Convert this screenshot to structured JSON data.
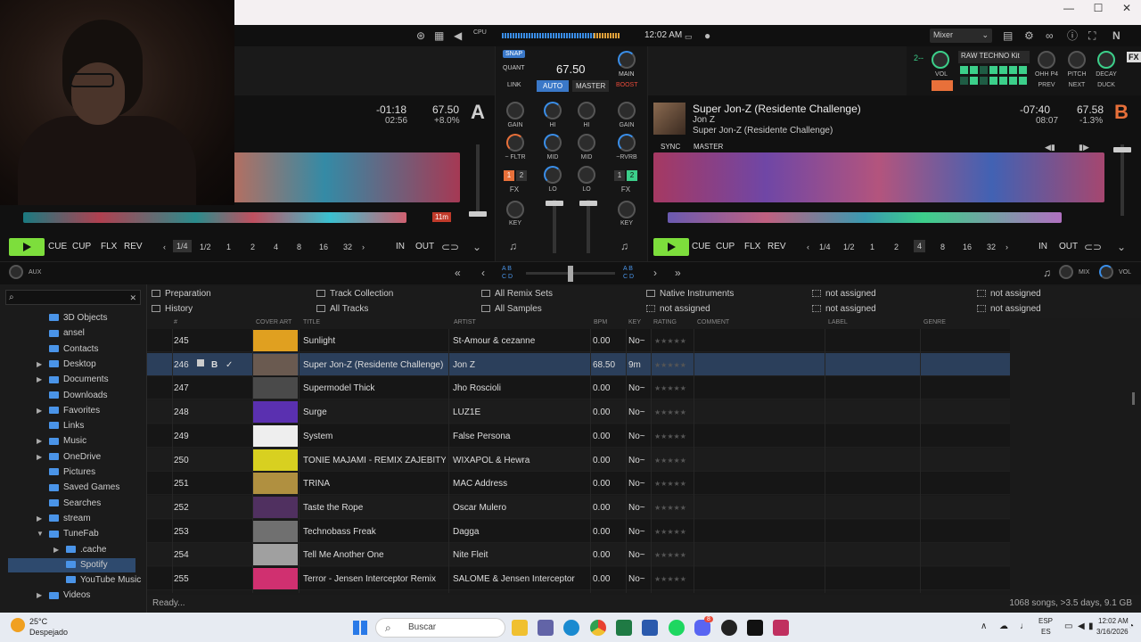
{
  "window": {
    "minimize": "—",
    "maximize": "☐",
    "close": "✕"
  },
  "header": {
    "cpu_label": "CPU",
    "clock": "12:02 AM",
    "layout_select": "Mixer"
  },
  "deckA": {
    "time_remaining": "-01:18",
    "time_total": "02:56",
    "bpm": "67.50",
    "pitch": "+8.0%",
    "letter": "A",
    "accent": "#cfcfcf",
    "transport": {
      "cue": "CUE",
      "cup": "CUP",
      "flx": "FLX",
      "rev": "REV",
      "in": "IN",
      "out": "OUT"
    },
    "beats": [
      "1/4",
      "1/2",
      "1",
      "2",
      "4",
      "8",
      "16",
      "32"
    ],
    "selected_beat": "1/4",
    "loop_length": "11m",
    "aux": "AUX"
  },
  "deckB": {
    "title": "Super Jon-Z (Residente Challenge)",
    "artist": "Jon Z",
    "album": "Super Jon-Z (Residente Challenge)",
    "time_remaining": "-07:40",
    "time_total": "08:07",
    "bpm": "67.58",
    "pitch": "-1.3%",
    "letter": "B",
    "accent": "#e8703a",
    "sync": "SYNC",
    "master": "MASTER",
    "transport": {
      "cue": "CUE",
      "cup": "CUP",
      "flx": "FLX",
      "rev": "REV",
      "in": "IN",
      "out": "OUT"
    },
    "beats": [
      "1/4",
      "1/2",
      "1",
      "2",
      "4",
      "8",
      "16",
      "32"
    ],
    "selected_beat": "4",
    "mix": "MIX",
    "vol": "VOL"
  },
  "mixer": {
    "snap": "SNAP",
    "quant": "QUANT",
    "master_bpm": "67.50",
    "main": "MAIN",
    "link": "LINK",
    "auto": "AUTO",
    "master": "MASTER",
    "boost": "BOOST",
    "gain": "GAIN",
    "hi": "HI",
    "mid": "MID",
    "lo": "LO",
    "fx": "FX",
    "key": "KEY",
    "fltr": "~ FLTR",
    "rvrb": "~RVRB",
    "fx_a": [
      "1",
      "2"
    ],
    "fx_b": [
      "1",
      "2"
    ]
  },
  "remix": {
    "deck_label": "2--",
    "kit": "RAW TECHNO Kit",
    "vol": "VOL",
    "ohh": "OHH P4",
    "pitch": "PITCH",
    "decay": "DECAY",
    "prev": "PREV",
    "next": "NEXT",
    "duck": "DUCK",
    "fx": "FX"
  },
  "crossfader": {
    "a_labels": [
      "A",
      "B",
      "C",
      "D"
    ],
    "b_labels": [
      "A",
      "B",
      "C",
      "D"
    ]
  },
  "sidebar": {
    "search_placeholder": "",
    "items": [
      {
        "label": "3D Objects",
        "arrow": ""
      },
      {
        "label": "ansel",
        "arrow": ""
      },
      {
        "label": "Contacts",
        "arrow": ""
      },
      {
        "label": "Desktop",
        "arrow": "▶"
      },
      {
        "label": "Documents",
        "arrow": "▶"
      },
      {
        "label": "Downloads",
        "arrow": ""
      },
      {
        "label": "Favorites",
        "arrow": "▶"
      },
      {
        "label": "Links",
        "arrow": ""
      },
      {
        "label": "Music",
        "arrow": "▶"
      },
      {
        "label": "OneDrive",
        "arrow": "▶"
      },
      {
        "label": "Pictures",
        "arrow": ""
      },
      {
        "label": "Saved Games",
        "arrow": ""
      },
      {
        "label": "Searches",
        "arrow": ""
      },
      {
        "label": "stream",
        "arrow": "▶"
      },
      {
        "label": "TuneFab",
        "arrow": "▼"
      },
      {
        "label": ".cache",
        "arrow": "▶"
      },
      {
        "label": "Spotify",
        "arrow": ""
      },
      {
        "label": "YouTube Music",
        "arrow": ""
      },
      {
        "label": "Videos",
        "arrow": "▶"
      }
    ]
  },
  "favorites": [
    [
      "Preparation",
      "Track Collection",
      "All Remix Sets",
      "Native Instruments",
      "not assigned",
      "not assigned"
    ],
    [
      "History",
      "All Tracks",
      "All Samples",
      "not assigned",
      "not assigned",
      "not assigned"
    ]
  ],
  "table": {
    "headers": {
      "num": "#",
      "cover": "COVER ART",
      "title": "TITLE",
      "artist": "ARTIST",
      "bpm": "BPM",
      "key": "KEY",
      "rating": "RATING",
      "comment": "COMMENT",
      "label": "LABEL",
      "genre": "GENRE"
    },
    "rows": [
      {
        "num": "245",
        "title": "Sunlight",
        "artist": "St-Amour & cezanne",
        "bpm": "0.00",
        "key": "No~",
        "cover": "#e0a020"
      },
      {
        "num": "246",
        "title": "Super Jon-Z (Residente Challenge)",
        "artist": "Jon Z",
        "bpm": "68.50",
        "key": "9m",
        "cover": "#6a5a50",
        "deck": "B",
        "flag": "✓"
      },
      {
        "num": "247",
        "title": "Supermodel Thick",
        "artist": "Jho Roscioli",
        "bpm": "0.00",
        "key": "No~",
        "cover": "#4a4a4a"
      },
      {
        "num": "248",
        "title": "Surge",
        "artist": "LUZ1E",
        "bpm": "0.00",
        "key": "No~",
        "cover": "#5a30b0"
      },
      {
        "num": "249",
        "title": "System",
        "artist": "False Persona",
        "bpm": "0.00",
        "key": "No~",
        "cover": "#eeeeee"
      },
      {
        "num": "250",
        "title": "TONIE MAJAMI - REMIX ZAJEBITY",
        "artist": "WIXAPOL & Hewra",
        "bpm": "0.00",
        "key": "No~",
        "cover": "#d8d020"
      },
      {
        "num": "251",
        "title": "TRINA",
        "artist": "MAC Address",
        "bpm": "0.00",
        "key": "No~",
        "cover": "#b09040"
      },
      {
        "num": "252",
        "title": "Taste the Rope",
        "artist": "Oscar Mulero",
        "bpm": "0.00",
        "key": "No~",
        "cover": "#503060"
      },
      {
        "num": "253",
        "title": "Technobass Freak",
        "artist": "Dagga",
        "bpm": "0.00",
        "key": "No~",
        "cover": "#707070"
      },
      {
        "num": "254",
        "title": "Tell Me Another One",
        "artist": "Nite Fleit",
        "bpm": "0.00",
        "key": "No~",
        "cover": "#a0a0a0"
      },
      {
        "num": "255",
        "title": "Terror - Jensen Interceptor Remix",
        "artist": "SALOME & Jensen Interceptor",
        "bpm": "0.00",
        "key": "No~",
        "cover": "#d03070"
      }
    ],
    "rating": "★★★★★"
  },
  "status": {
    "left": "Ready...",
    "right": "1068 songs, >3.5 days, 9.1 GB"
  },
  "taskbar": {
    "temp": "25°C",
    "weather": "Despejado",
    "search": "Buscar",
    "lang": "ESP",
    "lang2": "ES",
    "time": "12:02 AM",
    "date": "3/16/2026",
    "badge": "8"
  }
}
